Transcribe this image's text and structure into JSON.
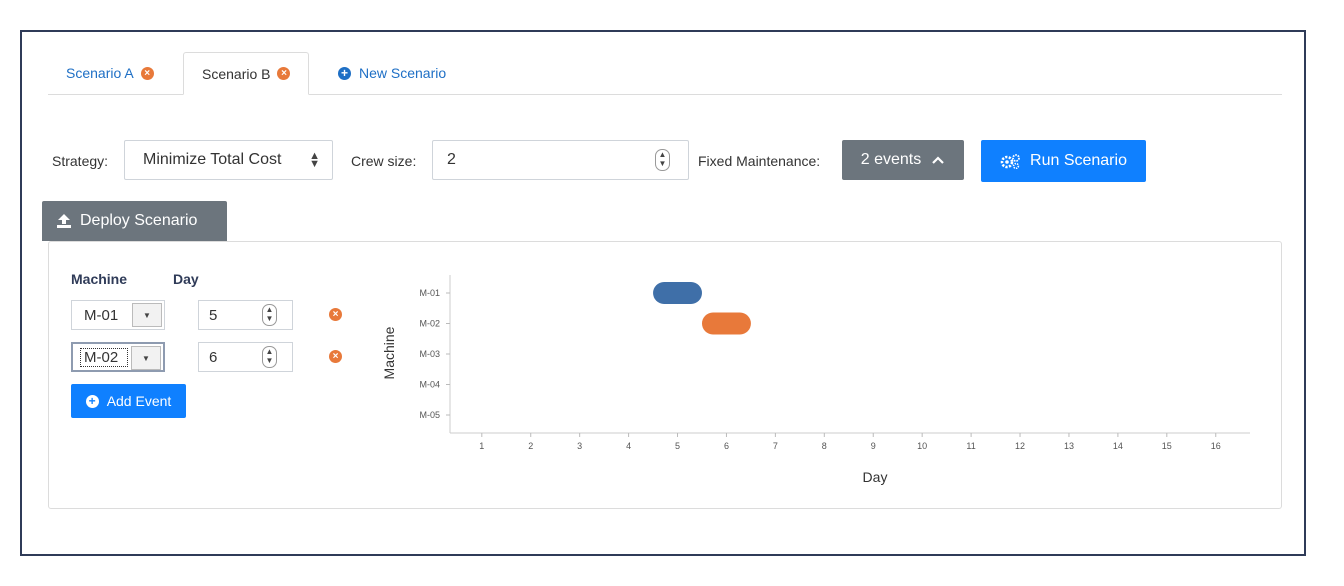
{
  "tabs": [
    {
      "label": "Scenario A",
      "active": false
    },
    {
      "label": "Scenario B",
      "active": true
    },
    {
      "label": "New Scenario",
      "active": false
    }
  ],
  "toolbar": {
    "strategy_label": "Strategy:",
    "strategy_value": "Minimize Total Cost",
    "crew_label": "Crew size:",
    "crew_value": "2",
    "fixed_label": "Fixed Maintenance:",
    "fixed_value": "2 events",
    "run_label": "Run Scenario",
    "deploy_label": "Deploy Scenario"
  },
  "events_table": {
    "col_machine": "Machine",
    "col_day": "Day",
    "rows": [
      {
        "machine": "M-01",
        "day": "5"
      },
      {
        "machine": "M-02",
        "day": "6"
      }
    ],
    "add_label": "Add Event"
  },
  "icons": {
    "remove": "close-circle-icon",
    "add": "plus-circle-icon",
    "upload": "upload-icon",
    "gears": "gears-icon",
    "chevron": "chevron-up-icon"
  },
  "colors": {
    "link_blue": "#1e6fc5",
    "primary": "#0f80ff",
    "secondary": "#6c757d",
    "remove": "#e8793a",
    "bar_m01": "#3f6fa8",
    "bar_m02": "#e8793a"
  },
  "chart_data": {
    "type": "gantt",
    "xlabel": "Day",
    "ylabel": "Machine",
    "x_ticks": [
      "1",
      "2",
      "3",
      "4",
      "5",
      "6",
      "7",
      "8",
      "9",
      "10",
      "11",
      "12",
      "13",
      "14",
      "15",
      "16"
    ],
    "y_ticks": [
      "M-01",
      "M-02",
      "M-03",
      "M-04",
      "M-05"
    ],
    "xlim": [
      0.35,
      16.7
    ],
    "bars": [
      {
        "machine": "M-01",
        "start": 4.5,
        "end": 5.5,
        "color": "#3f6fa8"
      },
      {
        "machine": "M-02",
        "start": 5.5,
        "end": 6.5,
        "color": "#e8793a"
      }
    ]
  }
}
